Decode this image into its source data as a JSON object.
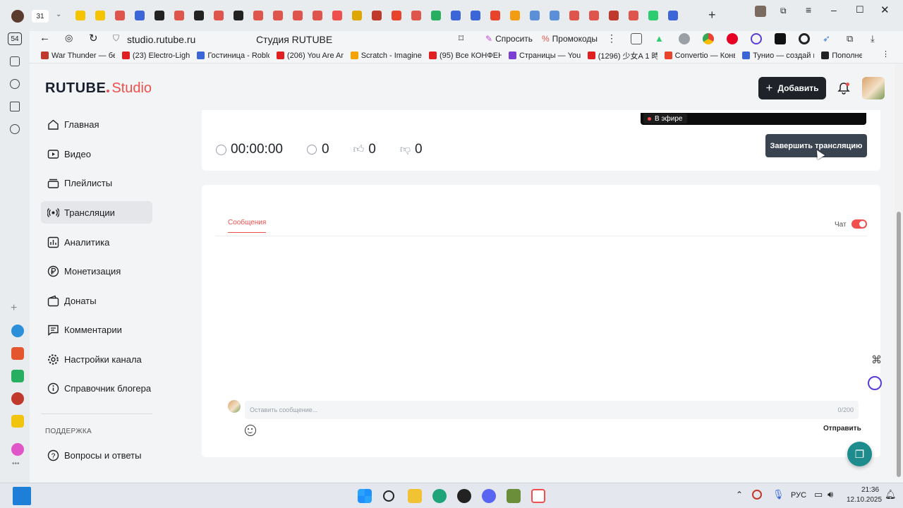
{
  "browser": {
    "tab_count": "31",
    "tab_count_left": "54",
    "address": "studio.rutube.ru",
    "page_title": "Студия RUTUBE",
    "ask_label": "Спросить",
    "promo_label": "Промокоды",
    "bookmarks": [
      {
        "label": "War Thunder — бе",
        "color": "#c0392b"
      },
      {
        "label": "(23) Electro-Light",
        "color": "#e02020"
      },
      {
        "label": "Гостиница - Roblc",
        "color": "#3a66d8"
      },
      {
        "label": "(206) You Are An",
        "color": "#e02020"
      },
      {
        "label": "Scratch - Imagine,",
        "color": "#f4a300"
      },
      {
        "label": "(95) Все КОНФЕН",
        "color": "#e02020"
      },
      {
        "label": "Страницы — Youl",
        "color": "#7b3fd1"
      },
      {
        "label": "(1296) 少女A 1 時",
        "color": "#e02020"
      },
      {
        "label": "Convertio — Конв",
        "color": "#e8442c"
      },
      {
        "label": "Тунио — создай к",
        "color": "#3a66d8"
      },
      {
        "label": "Пополне",
        "color": "#222222"
      }
    ]
  },
  "header": {
    "logo_main": "RUTUBE",
    "logo_studio": "Studio",
    "add_label": "Добавить"
  },
  "sidebar": {
    "items": [
      {
        "label": "Главная",
        "icon": "home-icon"
      },
      {
        "label": "Видео",
        "icon": "video-icon"
      },
      {
        "label": "Плейлисты",
        "icon": "playlist-icon"
      },
      {
        "label": "Трансляции",
        "icon": "broadcast-icon"
      },
      {
        "label": "Аналитика",
        "icon": "analytics-icon"
      },
      {
        "label": "Монетизация",
        "icon": "ruble-icon"
      },
      {
        "label": "Донаты",
        "icon": "wallet-icon"
      },
      {
        "label": "Комментарии",
        "icon": "comment-icon"
      },
      {
        "label": "Настройки канала",
        "icon": "gear-icon"
      },
      {
        "label": "Справочник блогера",
        "icon": "info-icon"
      }
    ],
    "support_heading": "ПОДДЕРЖКА",
    "faq_label": "Вопросы и ответы"
  },
  "stream": {
    "live_badge": "В эфире",
    "duration": "00:00:00",
    "viewers": "0",
    "likes": "0",
    "dislikes": "0",
    "end_button": "Завершить трансляцию"
  },
  "chat": {
    "tab_messages": "Сообщения",
    "chat_toggle_label": "Чат",
    "input_placeholder": "Оставить сообщение...",
    "counter": "0/200",
    "send_label": "Отправить",
    "accent": "#f0504d"
  },
  "taskbar": {
    "lang": "РУС",
    "time": "21:36",
    "date": "12.10.2025"
  }
}
